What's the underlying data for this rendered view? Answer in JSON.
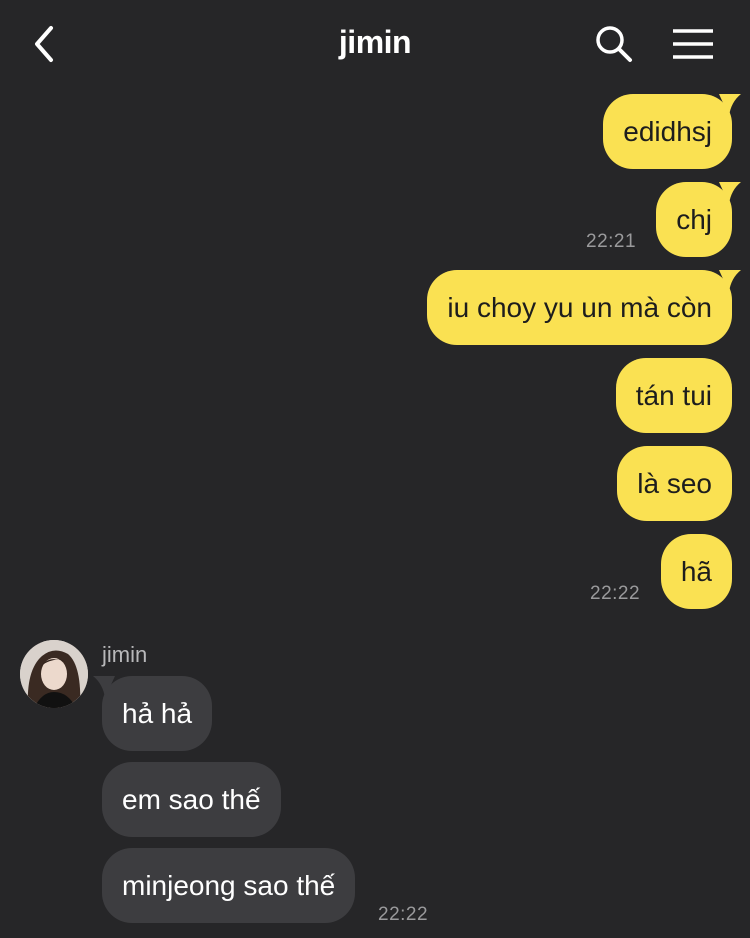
{
  "header": {
    "title": "jimin",
    "back_icon": "chevron-left-icon",
    "search_icon": "search-icon",
    "menu_icon": "hamburger-menu-icon"
  },
  "colors": {
    "background": "#262628",
    "outgoing_bubble": "#fae152",
    "incoming_bubble": "#3d3d40",
    "timestamp": "#9a9a9c"
  },
  "outgoing": [
    {
      "text": "edidhsj"
    },
    {
      "text": "chj",
      "time": "22:21"
    },
    {
      "text": "iu choy yu un mà còn"
    },
    {
      "text": "tán tui"
    },
    {
      "text": "là seo"
    },
    {
      "text": "hã",
      "time": "22:22"
    }
  ],
  "incoming": {
    "sender": "jimin",
    "messages": [
      {
        "text": "hả hả"
      },
      {
        "text": "em sao thế"
      },
      {
        "text": "minjeong sao thế",
        "time": "22:22"
      }
    ]
  }
}
